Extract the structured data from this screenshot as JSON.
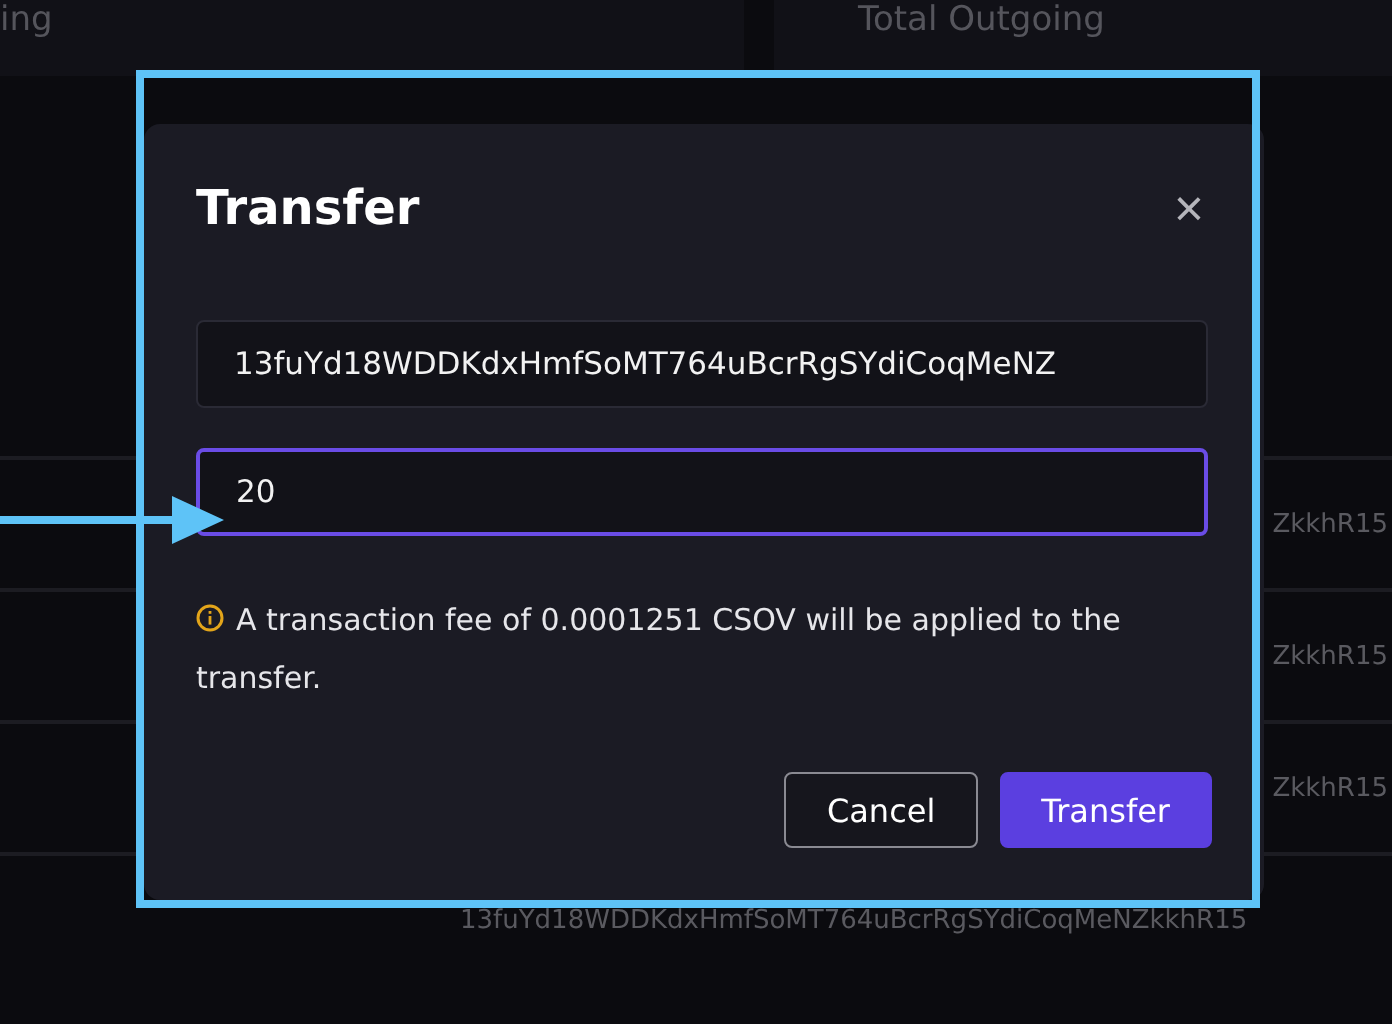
{
  "summary_cards": [
    {
      "label": "ing"
    },
    {
      "label": "Total Outgoing"
    }
  ],
  "table": {
    "rows": [
      {
        "cell": "ZkkhR15",
        "kind": "right"
      },
      {
        "cell": "ZkkhR15",
        "kind": "right"
      },
      {
        "cell": "ZkkhR15",
        "kind": "right"
      },
      {
        "cell": "13fuYd18WDDKdxHmfSoMT764uBcrRgSYdiCoqMeNZkkhR15",
        "kind": "full"
      }
    ]
  },
  "dialog": {
    "title": "Transfer",
    "close": "×",
    "address": {
      "value": "13fuYd18WDDKdxHmfSoMT764uBcrRgSYdiCoqMeNZ"
    },
    "amount": {
      "value": "20",
      "focused": true
    },
    "fee_note": "A transaction fee of 0.0001251 CSOV will be applied to the transfer.",
    "buttons": [
      {
        "label": "Cancel",
        "kind": "secondary"
      },
      {
        "label": "Transfer",
        "kind": "primary"
      }
    ]
  },
  "annotation": {
    "highlight": true,
    "arrow": true
  }
}
